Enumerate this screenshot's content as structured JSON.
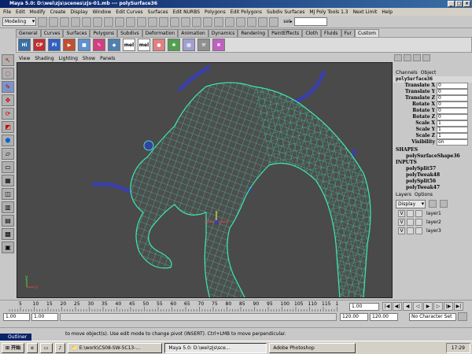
{
  "title": "Maya 5.0: D:\\wei\\zjs\\scenes\\zjs-01.mb  ---  polySurface36",
  "menu": [
    "File",
    "Edit",
    "Modify",
    "Create",
    "Display",
    "Window",
    "Edit Curves",
    "Surfaces",
    "Edit NURBS",
    "Polygons",
    "Edit Polygons",
    "Subdiv Surfaces",
    "MJ Poly Tools 1.3",
    "Next Limit",
    "Help"
  ],
  "status": {
    "mode": "Modeling",
    "sel_label": "sel▸"
  },
  "shelf_tabs": [
    "General",
    "Curves",
    "Surfaces",
    "Polygons",
    "Subdivs",
    "Deformation",
    "Animation",
    "Dynamics",
    "Rendering",
    "PaintEffects",
    "Cloth",
    "Fluids",
    "Fur",
    "Custom"
  ],
  "shelf_buttons": [
    "Hi",
    "CP",
    "FI",
    "mel",
    "mel"
  ],
  "panel_menu": [
    "View",
    "Shading",
    "Lighting",
    "Show",
    "Panels"
  ],
  "channelbox": {
    "menu": [
      "Channels",
      "Object"
    ],
    "node": "polySurface36",
    "attrs": [
      {
        "name": "Translate X",
        "value": "0"
      },
      {
        "name": "Translate Y",
        "value": "0"
      },
      {
        "name": "Translate Z",
        "value": "0"
      },
      {
        "name": "Rotate X",
        "value": "0"
      },
      {
        "name": "Rotate Y",
        "value": "0"
      },
      {
        "name": "Rotate Z",
        "value": "0"
      },
      {
        "name": "Scale X",
        "value": "1"
      },
      {
        "name": "Scale Y",
        "value": "1"
      },
      {
        "name": "Scale Z",
        "value": "1"
      },
      {
        "name": "Visibility",
        "value": "on"
      }
    ],
    "shapes_label": "SHAPES",
    "shape": "polySurfaceShape36",
    "inputs_label": "INPUTS",
    "inputs": [
      "polySplit57",
      "polyTweak48",
      "polySplit56",
      "polyTweak47"
    ]
  },
  "layers": {
    "menu": [
      "Layers",
      "Options"
    ],
    "display": "Display",
    "items": [
      {
        "v": "V",
        "name": "layer1"
      },
      {
        "v": "V",
        "name": "layer2"
      },
      {
        "v": "V",
        "name": "layer3"
      }
    ]
  },
  "timeline": {
    "ticks": [
      "5",
      "10",
      "15",
      "20",
      "25",
      "30",
      "35",
      "40",
      "45",
      "50",
      "55",
      "60",
      "65",
      "70",
      "75",
      "80",
      "85",
      "90",
      "95",
      "100",
      "105",
      "110",
      "115",
      "1"
    ],
    "current": "1.00"
  },
  "range": {
    "start": "1.00",
    "inner_start": "1.00",
    "inner_end": "120.00",
    "end": "120.00",
    "char_set": "No Character Set"
  },
  "help_line": "to move object(s). Use edit mode to change pivot (INSERT). Ctrl+LMB to move perpendicular.",
  "taskbar": {
    "start": "开始",
    "outliner_label": "Outliner",
    "tasks": [
      "E:\\work\\CS08-SW-5C13-...",
      "Maya 5.0: D:\\wei\\zjs\\sce...",
      "Adobe Photoshop"
    ],
    "clock": "17:29"
  },
  "axis": {
    "x": "x",
    "y": "y"
  }
}
